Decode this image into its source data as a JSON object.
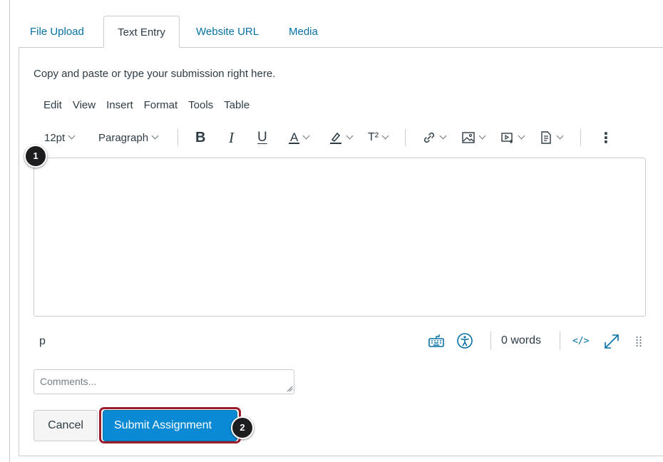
{
  "tabs": [
    {
      "label": "File Upload",
      "active": false
    },
    {
      "label": "Text Entry",
      "active": true
    },
    {
      "label": "Website URL",
      "active": false
    },
    {
      "label": "Media",
      "active": false
    }
  ],
  "instructions": "Copy and paste or type your submission right here.",
  "menubar": [
    "Edit",
    "View",
    "Insert",
    "Format",
    "Tools",
    "Table"
  ],
  "toolbar": {
    "font_size": "12pt",
    "block_format": "Paragraph",
    "bold": "B",
    "italic": "I",
    "underline": "U",
    "text_color": "A",
    "superscript": "T²",
    "more": "⋮"
  },
  "editor": {
    "content": ""
  },
  "statusbar": {
    "path": "p",
    "word_count": "0 words",
    "html_toggle": "</>"
  },
  "comments": {
    "placeholder": "Comments...",
    "value": ""
  },
  "buttons": {
    "cancel": "Cancel",
    "submit": "Submit Assignment"
  },
  "badges": {
    "one": "1",
    "two": "2"
  },
  "colors": {
    "link_blue": "#0770a3",
    "submit_blue": "#0a8ad4",
    "highlight_ring": "#9b1c2c",
    "border": "#c7cdd1",
    "text": "#2d3b45"
  }
}
